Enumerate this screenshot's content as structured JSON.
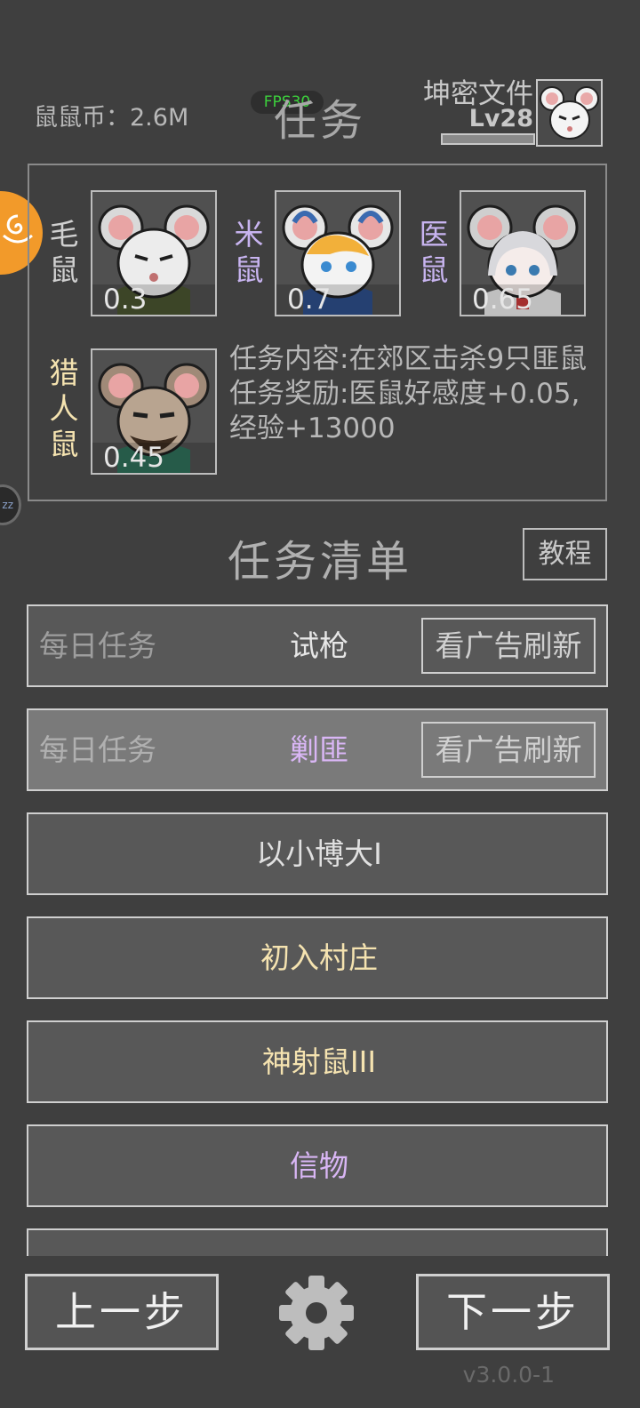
{
  "header": {
    "coins_label": "鼠鼠币：2.6M",
    "fps": "FPS30",
    "title": "任务",
    "player_name": "坤密文件",
    "player_level": "Lv28",
    "xp_progress_percent": 100
  },
  "npcs": [
    {
      "name": "毛\n鼠",
      "value": "0.3",
      "name_color": "#d0d0d0"
    },
    {
      "name": "米\n鼠",
      "value": "0.7",
      "name_color": "#c8b4f0"
    },
    {
      "name": "医\n鼠",
      "value": "0.65",
      "name_color": "#c8b4f0"
    },
    {
      "name": "猎\n人\n鼠",
      "value": "0.45",
      "name_color": "#f5e3b0"
    }
  ],
  "task": {
    "content": "任务内容:在郊区击杀9只匪鼠",
    "reward": "任务奖励:医鼠好感度+0.05,经验+13000"
  },
  "task_list": {
    "title": "任务清单",
    "tutorial_label": "教程",
    "daily_label": "每日任务",
    "refresh_label": "看广告刷新",
    "rows": [
      {
        "name": "试枪",
        "daily": true,
        "color": "#e6e6e6"
      },
      {
        "name": "剿匪",
        "daily": true,
        "color": "#d9b6f5"
      },
      {
        "name": "以小博大I",
        "daily": false,
        "color": "#e0e0e0"
      },
      {
        "name": "初入村庄",
        "daily": false,
        "color": "#f5e3b0"
      },
      {
        "name": "神射鼠III",
        "daily": false,
        "color": "#f5e3b0"
      },
      {
        "name": "信物",
        "daily": false,
        "color": "#d9b6f5"
      },
      {
        "name": "",
        "daily": false,
        "color": "#e0e0e0"
      }
    ]
  },
  "footer": {
    "prev_label": "上一步",
    "next_label": "下一步",
    "version": "v3.0.0-1"
  }
}
